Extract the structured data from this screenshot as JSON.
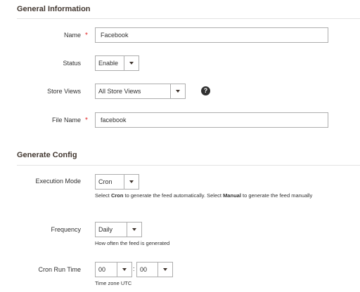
{
  "general": {
    "title": "General Information",
    "name_label": "Name",
    "name_value": "Facebook",
    "status_label": "Status",
    "status_value": "Enable",
    "store_views_label": "Store Views",
    "store_views_value": "All Store Views",
    "help_glyph": "?",
    "file_name_label": "File Name",
    "file_name_value": "facebook",
    "required_mark": "*"
  },
  "config": {
    "title": "Generate Config",
    "execution_label": "Execution Mode",
    "execution_value": "Cron",
    "execution_note_pre": "Select ",
    "execution_note_b1": "Cron",
    "execution_note_mid": " to generate the feed automatically. Select ",
    "execution_note_b2": "Manual",
    "execution_note_post": " to generate the feed manually",
    "frequency_label": "Frequency",
    "frequency_value": "Daily",
    "frequency_note": "How often the feed is generated",
    "cron_label": "Cron Run Time",
    "cron_hour": "00",
    "cron_minute": "00",
    "cron_separator": ":",
    "cron_note": "Time zone UTC"
  }
}
